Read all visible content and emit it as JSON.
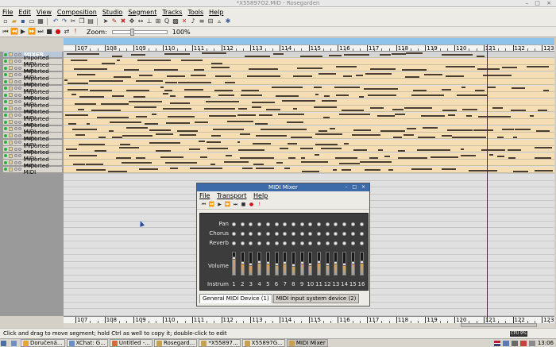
{
  "window": {
    "title": "*X55897O2.MID - Rosegarden",
    "controls": "– □ ×"
  },
  "menu": [
    "File",
    "Edit",
    "View",
    "Composition",
    "Studio",
    "Segment",
    "Tracks",
    "Tools",
    "Help"
  ],
  "toolbar": {
    "zoom_label": "Zoom:",
    "zoom_value": "100%",
    "zoom_fraction": 0.35
  },
  "ruler": {
    "bars": [
      "107",
      "108",
      "109",
      "110",
      "111",
      "112",
      "113",
      "114",
      "115",
      "116",
      "117",
      "118",
      "119",
      "120",
      "121",
      "122",
      "123"
    ]
  },
  "tracks": [
    {
      "label": "MIXER",
      "kind": "mixer"
    },
    {
      "label": "Imported MIDI"
    },
    {
      "label": "Imported MIDI"
    },
    {
      "label": "Imported MIDI"
    },
    {
      "label": "Imported MIDI"
    },
    {
      "label": "Imported MIDI"
    },
    {
      "label": "Imported MIDI"
    },
    {
      "label": "Imported MIDI"
    },
    {
      "label": "Imported MIDI"
    },
    {
      "label": "Imported MIDI"
    },
    {
      "label": "Imported MIDI"
    },
    {
      "label": "Imported MIDI"
    },
    {
      "label": "Imported MIDI"
    },
    {
      "label": "Imported MIDI"
    },
    {
      "label": "Imported MIDI"
    },
    {
      "label": "Imported MIDI"
    },
    {
      "label": "Imported MIDI"
    },
    {
      "label": "Imported MIDI"
    }
  ],
  "status": {
    "message": "Click and drag to move segment; hold Ctrl as well to copy it; double-click to edit",
    "cpu": "CPU 9%"
  },
  "taskbar": {
    "items": [
      {
        "label": "Doručená...",
        "color": "#e8a830"
      },
      {
        "label": "XChat: G...",
        "color": "#6a8ec8"
      },
      {
        "label": "Untitled -...",
        "color": "#d86a3a"
      },
      {
        "label": "Rosegard...",
        "color": "#c8a050"
      },
      {
        "label": "*X55897...",
        "color": "#c8a050"
      },
      {
        "label": "X55897G...",
        "color": "#c8a050"
      },
      {
        "label": "MIDI Mixer",
        "color": "#c8a050"
      }
    ],
    "clock": "13:06"
  },
  "mixer": {
    "title": "MIDI Mixer",
    "controls": "– □ ×",
    "menu": [
      "File",
      "Transport",
      "Help"
    ],
    "row_labels": {
      "pan": "Pan",
      "chorus": "Chorus",
      "reverb": "Reverb",
      "volume": "Volume",
      "instrument": "Instrum"
    },
    "channels": [
      "1",
      "2",
      "3",
      "4",
      "5",
      "6",
      "7",
      "8",
      "9",
      "10",
      "11",
      "12",
      "13",
      "14",
      "15",
      "16"
    ],
    "volume_levels": [
      0.8,
      0.55,
      0.5,
      0.6,
      0.55,
      0.5,
      0.55,
      0.45,
      0.55,
      0.5,
      0.6,
      0.5,
      0.55,
      0.5,
      0.55,
      0.6
    ],
    "tabs": [
      "General MIDI Device (1)",
      "MIDI input system device (2)"
    ]
  }
}
